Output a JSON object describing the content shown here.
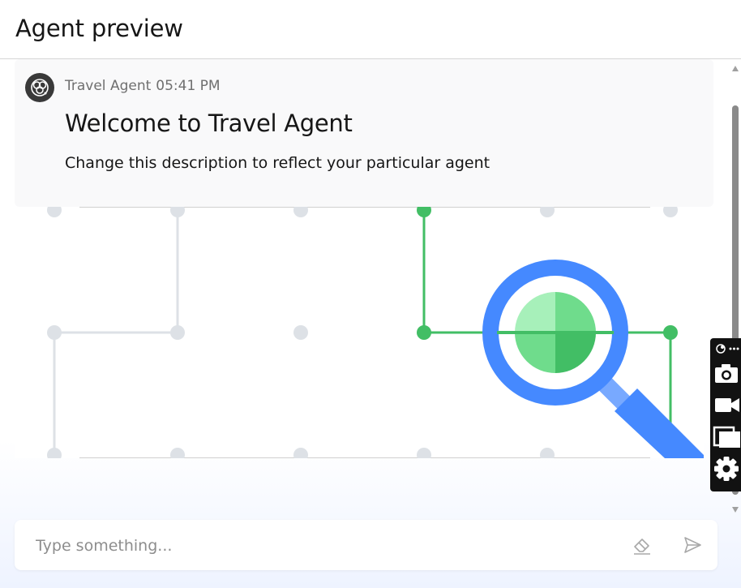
{
  "header": {
    "title": "Agent preview"
  },
  "message": {
    "sender": "Travel Agent",
    "time": "05:41 PM",
    "heading": "Welcome to Travel Agent",
    "description": "Change this description to reflect your particular agent"
  },
  "composer": {
    "placeholder": "Type something..."
  },
  "toolbar": {
    "items": [
      "logo-icon",
      "more-icon",
      "camera-icon",
      "video-icon",
      "copy-icon",
      "gear-icon"
    ]
  },
  "colors": {
    "accent_blue": "#4589ff",
    "accent_green": "#42be65",
    "light_green": "#a7f0ba",
    "mid_green": "#6fdc8c",
    "grid_gray": "#dde1e6"
  }
}
